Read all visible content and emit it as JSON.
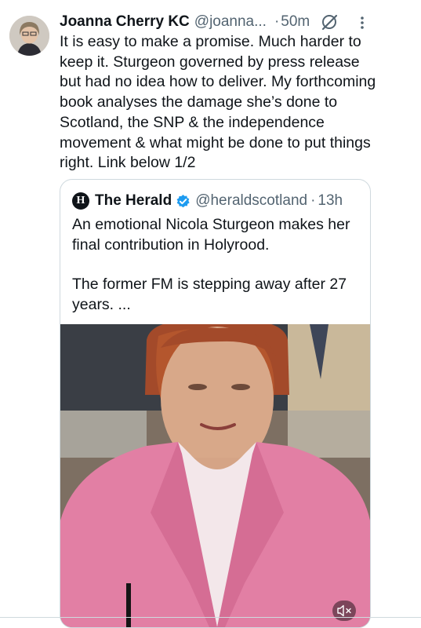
{
  "tweet": {
    "author_name": "Joanna Cherry KC",
    "author_handle": "@joanna...",
    "separator": "·",
    "time": "50m",
    "text": "It is easy to make a promise. Much harder to keep it. Sturgeon governed by press release but had no idea how to deliver. My forthcoming book analyses the damage she’s done to Scotland, the SNP & the independence movement & what might be done to put things right. Link below 1/2",
    "icons": [
      "avatar",
      "grok-icon",
      "more-icon"
    ]
  },
  "quote": {
    "logo_text": "H",
    "name": "The Herald",
    "handle": "@heraldscotland",
    "separator": "·",
    "time": "13h",
    "paragraph1": "An emotional Nicola Sturgeon makes her final contribution in Holyrood.",
    "paragraph2": "The former FM is stepping away after 27 years. ...",
    "icons": [
      "verified-badge-icon",
      "video-thumbnail",
      "mute-icon"
    ]
  },
  "colors": {
    "text": "#0f1419",
    "secondary": "#536471",
    "border": "#cfd9de",
    "verified": "#1d9bf0",
    "jacket": "#e27fa4"
  }
}
